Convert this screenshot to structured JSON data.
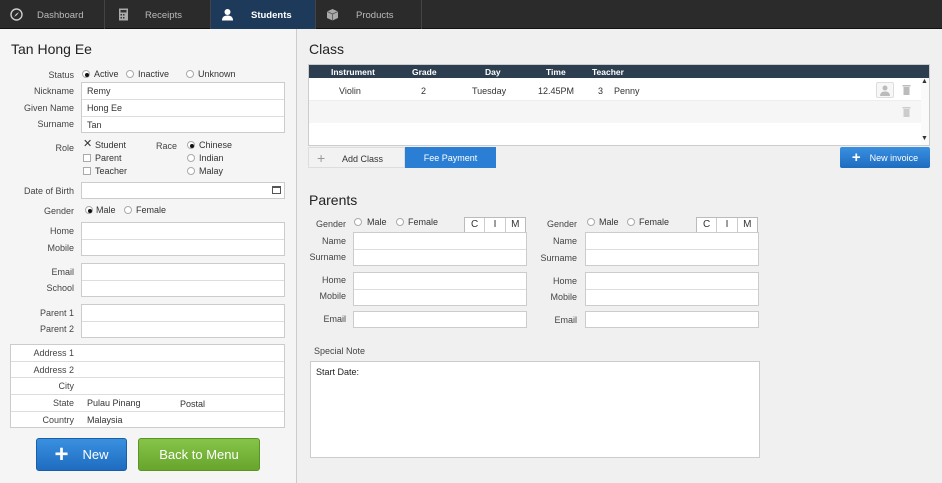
{
  "nav": {
    "tabs": [
      {
        "label": "Dashboard",
        "icon": "compass-icon"
      },
      {
        "label": "Receipts",
        "icon": "calculator-icon"
      },
      {
        "label": "Students",
        "icon": "person-icon"
      },
      {
        "label": "Products",
        "icon": "box-icon"
      }
    ]
  },
  "student": {
    "name": "Tan Hong Ee",
    "status_label": "Status",
    "status_options": [
      "Active",
      "Inactive",
      "Unknown"
    ],
    "status_selected": "Active",
    "nickname_label": "Nickname",
    "nickname": "Remy",
    "given_name_label": "Given Name",
    "given_name": "Hong Ee",
    "surname_label": "Surname",
    "surname": "Tan",
    "role_label": "Role",
    "roles": [
      {
        "label": "Student",
        "checked": true
      },
      {
        "label": "Parent",
        "checked": false
      },
      {
        "label": "Teacher",
        "checked": false
      }
    ],
    "race_label": "Race",
    "race_options": [
      "Chinese",
      "Indian",
      "Malay"
    ],
    "race_selected": "Chinese",
    "dob_label": "Date of Birth",
    "dob": "",
    "gender_label": "Gender",
    "gender_options": [
      "Male",
      "Female"
    ],
    "gender_selected": "Male",
    "home_label": "Home",
    "home": "",
    "mobile_label": "Mobile",
    "mobile": "",
    "email_label": "Email",
    "email": "",
    "school_label": "School",
    "school": "",
    "parent1_label": "Parent 1",
    "parent1": "",
    "parent2_label": "Parent 2",
    "parent2": "",
    "address1_label": "Address 1",
    "address1": "",
    "address2_label": "Address 2",
    "address2": "",
    "city_label": "City",
    "city": "",
    "state_label": "State",
    "state": "Pulau Pinang",
    "postal_label": "Postal",
    "postal": "",
    "country_label": "Country",
    "country": "Malaysia"
  },
  "buttons": {
    "new": "New",
    "back": "Back to Menu"
  },
  "class_section": {
    "title": "Class",
    "columns": [
      "Instrument",
      "Grade",
      "Day",
      "Time",
      "Teacher"
    ],
    "rows": [
      {
        "instrument": "Violin",
        "grade": "2",
        "day": "Tuesday",
        "time": "12.45PM",
        "teacher_no": "3",
        "teacher": "Penny"
      }
    ],
    "add_class": "Add Class",
    "fee_payment": "Fee Payment",
    "new_invoice": "New invoice"
  },
  "parents_section": {
    "title": "Parents",
    "gender_label": "Gender",
    "gender_options": [
      "Male",
      "Female"
    ],
    "cim": [
      "C",
      "I",
      "M"
    ],
    "name_label": "Name",
    "surname_label": "Surname",
    "home_label": "Home",
    "mobile_label": "Mobile",
    "email_label": "Email",
    "special_note_label": "Special Note",
    "special_note": "Start Date:"
  },
  "colors": {
    "accent": "#2a7fd4",
    "nav_active": "#1e3a5a",
    "table_header": "#2c3e50",
    "green": "#77b53a"
  }
}
